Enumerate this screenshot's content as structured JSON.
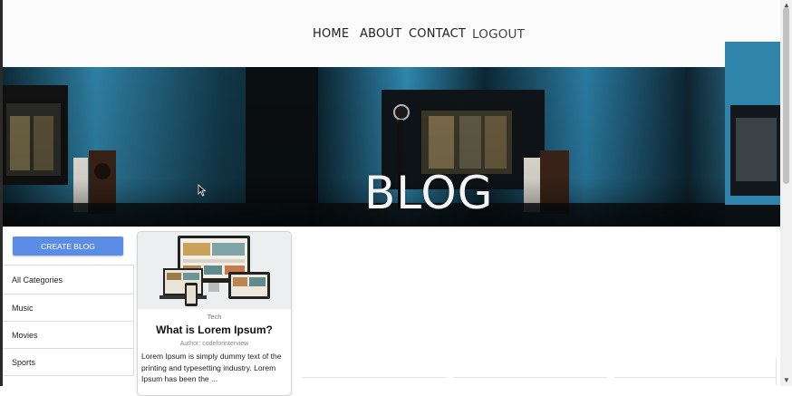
{
  "nav": {
    "home": "HOME",
    "about": "ABOUT",
    "contact": "CONTACT",
    "logout": "LOGOUT"
  },
  "hero": {
    "title": "BLOG"
  },
  "sidebar": {
    "create_button": "CREATE BLOG",
    "categories": [
      "All Categories",
      "Music",
      "Movies",
      "Sports"
    ]
  },
  "post": {
    "category": "Tech",
    "title": "What is Lorem Ipsum?",
    "author": "Author: codeforinterview",
    "description": "Lorem Ipsum is simply dummy text of the printing and typesetting industry. Lorem Ipsum has been the ..."
  },
  "colors": {
    "create_button": "#5b8ce6",
    "hero_tint": "#1c6b8c"
  }
}
